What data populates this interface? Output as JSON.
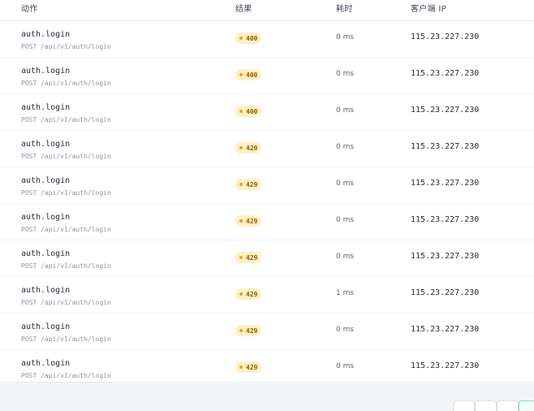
{
  "table": {
    "headers": {
      "action": "动作",
      "result": "结果",
      "duration": "耗时",
      "client_ip": "客户端 IP"
    },
    "rows": [
      {
        "action": "auth.login",
        "path": "POST /api/v1/auth/login",
        "status": "400",
        "duration": "0 ms",
        "ip": "115.23.227.230"
      },
      {
        "action": "auth.login",
        "path": "POST /api/v1/auth/login",
        "status": "400",
        "duration": "0 ms",
        "ip": "115.23.227.230"
      },
      {
        "action": "auth.login",
        "path": "POST /api/v1/auth/login",
        "status": "400",
        "duration": "0 ms",
        "ip": "115.23.227.230"
      },
      {
        "action": "auth.login",
        "path": "POST /api/v1/auth/login",
        "status": "429",
        "duration": "0 ms",
        "ip": "115.23.227.230"
      },
      {
        "action": "auth.login",
        "path": "POST /api/v1/auth/login",
        "status": "429",
        "duration": "0 ms",
        "ip": "115.23.227.230"
      },
      {
        "action": "auth.login",
        "path": "POST /api/v1/auth/login",
        "status": "429",
        "duration": "0 ms",
        "ip": "115.23.227.230"
      },
      {
        "action": "auth.login",
        "path": "POST /api/v1/auth/login",
        "status": "429",
        "duration": "0 ms",
        "ip": "115.23.227.230"
      },
      {
        "action": "auth.login",
        "path": "POST /api/v1/auth/login",
        "status": "429",
        "duration": "1 ms",
        "ip": "115.23.227.230"
      },
      {
        "action": "auth.login",
        "path": "POST /api/v1/auth/login",
        "status": "429",
        "duration": "0 ms",
        "ip": "115.23.227.230"
      },
      {
        "action": "auth.login",
        "path": "POST /api/v1/auth/login",
        "status": "429",
        "duration": "0 ms",
        "ip": "115.23.227.230"
      }
    ]
  },
  "colors": {
    "status_badge_bg": "#fdf1c4",
    "status_badge_text": "#8a5a00",
    "status_dot": "#e8a51a",
    "pager_active_border": "#7fd8c4"
  },
  "pagination": {
    "visible_buttons": 4,
    "active_index": 3
  }
}
